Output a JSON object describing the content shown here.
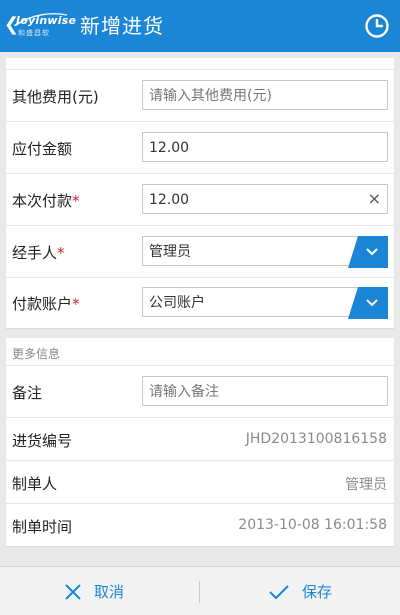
{
  "header": {
    "back_logo_en": "Joyinwise",
    "back_logo_cn": "和盛昌软",
    "title": "新增进货",
    "accent": "#1b86d6"
  },
  "form": {
    "other_fees": {
      "label": "其他费用(元)",
      "placeholder": "请输入其他费用(元)"
    },
    "payable": {
      "label": "应付金额",
      "value": "12.00"
    },
    "this_payment": {
      "label": "本次付款",
      "required": "*",
      "value": "12.00",
      "clear_icon": "×"
    },
    "handler": {
      "label": "经手人",
      "required": "*",
      "value": "管理员"
    },
    "account": {
      "label": "付款账户",
      "required": "*",
      "value": "公司账户"
    }
  },
  "more_info": {
    "section_title": "更多信息",
    "remark": {
      "label": "备注",
      "placeholder": "请输入备注"
    },
    "purchase_no": {
      "label": "进货编号",
      "value": "JHD2013100816158"
    },
    "creator": {
      "label": "制单人",
      "value": "管理员"
    },
    "created_time": {
      "label": "制单时间",
      "value": "2013-10-08 16:01:58"
    }
  },
  "footer": {
    "cancel_label": "取消",
    "save_label": "保存"
  },
  "icons": {
    "back": "back-chevron-icon",
    "clock": "clock-icon",
    "clear": "clear-icon",
    "dropdown": "chevron-down-icon",
    "cancel": "close-icon",
    "save": "checkmark-icon"
  }
}
